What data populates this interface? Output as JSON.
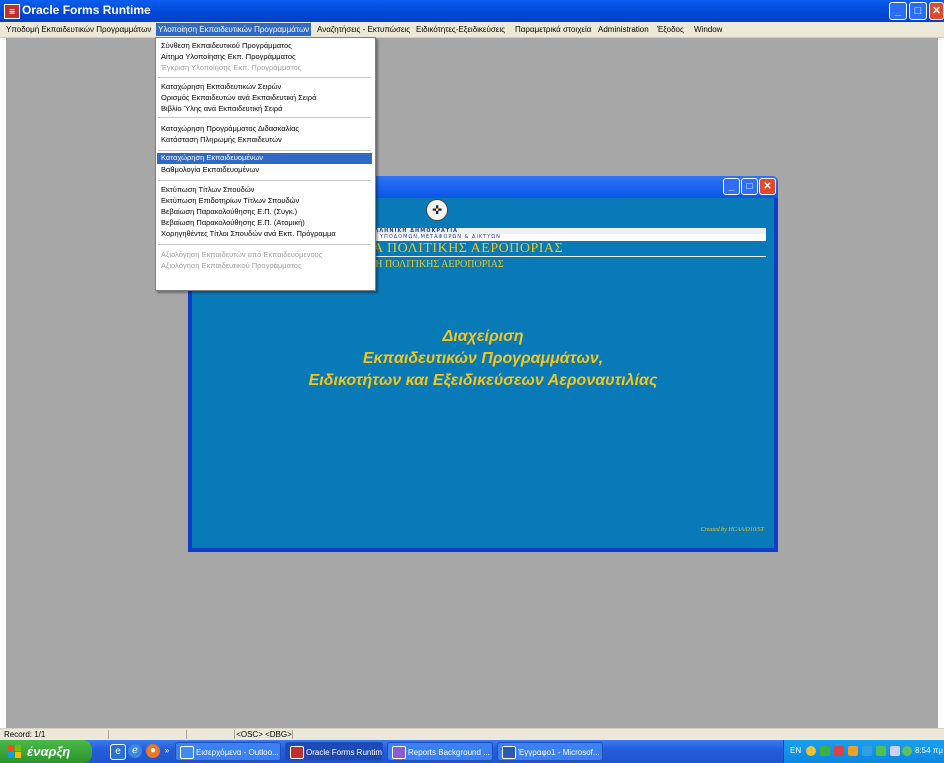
{
  "window": {
    "title": "Oracle Forms Runtime",
    "app_icon": "oracle-forms-icon",
    "minimize": "_",
    "maximize": "□",
    "close": "✕"
  },
  "menubar": [
    "Υποδομή Εκπαιδευτικών Προγραμμάτων",
    "Υλοποίηση Εκπαιδευτικών Προγραμμάτων",
    "Αναζητήσεις - Εκτυπώσεις",
    "Ειδικότητες-Εξειδικεύσεις",
    "Παραμετρικά στοιχεία",
    "Administration",
    "Έξοδος",
    "Window"
  ],
  "dropdown": {
    "items": [
      {
        "label": "Σύνθεση Εκπαιδευτικού Προγράμματος",
        "state": "normal"
      },
      {
        "label": "Αίτημα Υλοποίησης Εκπ. Προγράμματος",
        "state": "normal"
      },
      {
        "label": "Έγκριση Υλοποίησης Εκπ. Προγράμματος",
        "state": "disabled"
      },
      {
        "label": "Καταχώρηση Εκπαιδευτικών Σειρών",
        "state": "normal"
      },
      {
        "label": "Ορισμός Εκπαιδευτών ανά Εκπαιδευτική Σειρά",
        "state": "normal"
      },
      {
        "label": "Βιβλίο Ύλης ανά Εκπαιδευτική Σειρά",
        "state": "normal"
      },
      {
        "label": "Καταχώρηση Προγράμματος Διδασκαλίας",
        "state": "normal"
      },
      {
        "label": "Κατάσταση Πληρωμής Εκπαιδευτών",
        "state": "normal"
      },
      {
        "label": "Καταχώρηση Εκπαιδευομένων",
        "state": "highlighted"
      },
      {
        "label": "Βαθμολογία Εκπαιδευομένων",
        "state": "normal"
      },
      {
        "label": "Εκτύπωση Τίτλων Σπουδών",
        "state": "normal"
      },
      {
        "label": "Εκτύπωση Επιδοτηρίων Τίτλων Σπουδών",
        "state": "normal"
      },
      {
        "label": "Βεβαίωση Παρακολούθησης Ε.Π. (Συγκ.)",
        "state": "normal"
      },
      {
        "label": "Βεβαίωση Παρακολούθησης Ε.Π. (Ατομική)",
        "state": "normal"
      },
      {
        "label": "Χορηγηθέντες Τίτλοι Σπουδών ανά Εκπ. Πρόγραμμα",
        "state": "normal"
      },
      {
        "label": "Αξιολόγηση Εκπαιδευτών από Εκπαιδευόμενους",
        "state": "disabled"
      },
      {
        "label": "Αξιολόγηση Εκπαιδευτικού Προγράμματος",
        "state": "disabled"
      }
    ]
  },
  "form": {
    "emblem": "greek-coat-of-arms-icon",
    "strip1": "ΕΛΛΗΝΙΚΗ ΔΗΜΟΚΡΑΤΙΑ",
    "strip2": "ΙΟ ΥΠΟΔΟΜΩΝ,ΜΕΤΑΦΟΡΩΝ & ΔΙΚΤΥΩΝ",
    "headline1": "ΙΑ ΠΟΛΙΤΙΚΗΣ ΑΕΡΟΠΟΡΙΑΣ",
    "headline2": "ΛΗ ΠΟΛΙΤΙΚΗΣ ΑΕΡΟΠΟΡΙΑΣ",
    "title_lines": [
      "Διαχείριση",
      "Εκπαιδευτικών Προγραμμάτων,",
      "Ειδικοτήτων και Εξειδικεύσεων Αεροναυτιλίας"
    ],
    "credit": "Created by HCAA/D10/ST"
  },
  "statusbar": {
    "record": "Record: 1/1",
    "cell3": "<OSC> <DBG>"
  },
  "taskbar": {
    "start": "έναρξη",
    "quicklaunch": [
      "ie-icon",
      "outlook-express-icon",
      "firefox-icon"
    ],
    "chevron": "»",
    "tasks": [
      {
        "label": "Εισερχόμενα - Outloo...",
        "icon": "outlook-icon",
        "active": false
      },
      {
        "label": "Oracle Forms Runtime",
        "icon": "oracle-forms-icon",
        "active": true
      },
      {
        "label": "Reports Background ...",
        "icon": "reports-icon",
        "active": false
      },
      {
        "label": "Έγγραφο1 - Microsof...",
        "icon": "word-icon",
        "active": false
      }
    ],
    "tray_lang": "EN",
    "clock": "8:54 πμ"
  },
  "colors": {
    "highlight": "#316ac5",
    "form_bg": "#087ab8",
    "form_text": "#f4c518",
    "workspace": "#a7a7a7"
  }
}
